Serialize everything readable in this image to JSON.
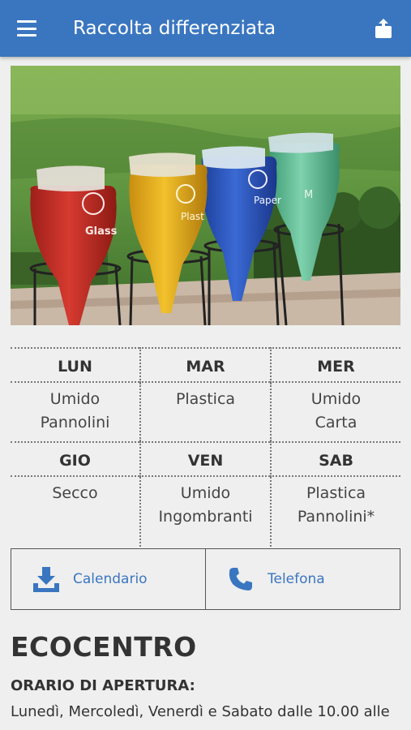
{
  "app_bar": {
    "title": "Raccolta differenziata",
    "menu_icon": "hamburger-menu-icon",
    "share_icon": "share-icon",
    "color": "#3a76c0"
  },
  "hero": {
    "bins": [
      "Glass",
      "Plastic",
      "Paper",
      ""
    ],
    "bin_colors": [
      "#c9332b",
      "#e8b21f",
      "#2f5fc4",
      "#6cc7a0"
    ]
  },
  "schedule": {
    "row1": {
      "days": [
        "LUN",
        "MAR",
        "MER"
      ],
      "items": [
        [
          "Umido",
          "Pannolini"
        ],
        [
          "Plastica"
        ],
        [
          "Umido",
          "Carta"
        ]
      ]
    },
    "row2": {
      "days": [
        "GIO",
        "VEN",
        "SAB"
      ],
      "items": [
        [
          "Secco"
        ],
        [
          "Umido",
          "Ingombranti"
        ],
        [
          "Plastica",
          "Pannolini*"
        ]
      ]
    }
  },
  "actions": {
    "calendar": {
      "label": "Calendario",
      "icon": "download-icon"
    },
    "phone": {
      "label": "Telefona",
      "icon": "phone-icon"
    }
  },
  "ecocentro": {
    "title": "ECOCENTRO",
    "hours_title": "ORARIO DI APERTURA:",
    "hours_text": "Lunedì, Mercoledì, Venerdì e Sabato dalle 10.00 alle"
  }
}
